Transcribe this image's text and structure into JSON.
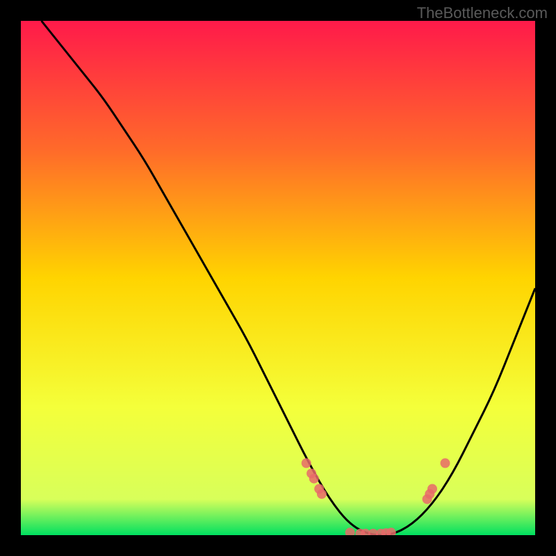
{
  "watermark": "TheBottleneck.com",
  "chart_data": {
    "type": "line",
    "title": "",
    "xlabel": "",
    "ylabel": "",
    "xlim": [
      0,
      100
    ],
    "ylim": [
      0,
      100
    ],
    "gradient_stops": [
      {
        "offset": 0,
        "color": "#ff1a4a"
      },
      {
        "offset": 25,
        "color": "#ff6a2a"
      },
      {
        "offset": 50,
        "color": "#ffd400"
      },
      {
        "offset": 75,
        "color": "#f4ff3a"
      },
      {
        "offset": 93,
        "color": "#d8ff5a"
      },
      {
        "offset": 100,
        "color": "#00e060"
      }
    ],
    "series": [
      {
        "name": "curve",
        "x": [
          4,
          8,
          12,
          16,
          20,
          24,
          28,
          32,
          36,
          40,
          44,
          48,
          52,
          56,
          60,
          64,
          68,
          72,
          76,
          80,
          84,
          88,
          92,
          96,
          100
        ],
        "y": [
          100,
          95,
          90,
          85,
          79,
          73,
          66,
          59,
          52,
          45,
          38,
          30,
          22,
          14,
          7,
          2,
          0,
          0,
          2,
          6,
          12,
          20,
          28,
          38,
          48
        ]
      }
    ],
    "markers": {
      "name": "highlight-points",
      "color": "#e86a6a",
      "x": [
        55.5,
        56.5,
        57,
        58,
        58.5,
        64,
        66,
        67,
        68.5,
        70,
        71,
        72,
        79,
        79.5,
        80,
        82.5
      ],
      "y": [
        14,
        12,
        11,
        9,
        8,
        0.5,
        0.3,
        0.3,
        0.3,
        0.3,
        0.4,
        0.5,
        7,
        8,
        9,
        14
      ]
    }
  }
}
